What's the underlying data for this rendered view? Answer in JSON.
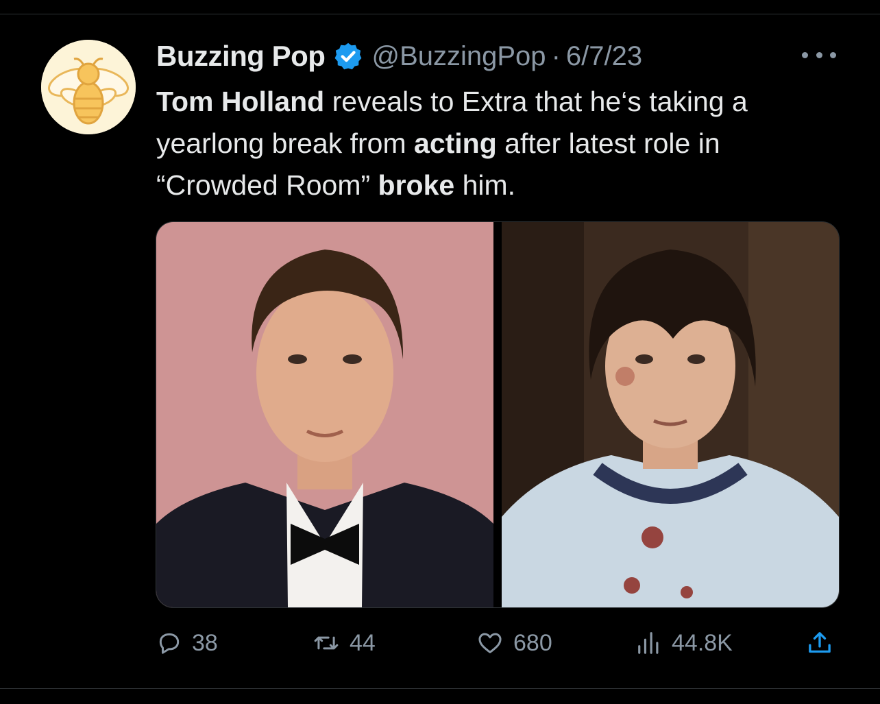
{
  "tweet": {
    "author_name": "Buzzing Pop",
    "handle": "@BuzzingPop",
    "separator": "·",
    "date": "6/7/23",
    "verified_color": "#1d9bf0",
    "text_segments": [
      {
        "text": "Tom Holland",
        "bold": true
      },
      {
        "text": " reveals to Extra that he‘s taking a yearlong break from ",
        "bold": false
      },
      {
        "text": "acting",
        "bold": true
      },
      {
        "text": " after latest role in “Crowded Room” ",
        "bold": false
      },
      {
        "text": "broke",
        "bold": true
      },
      {
        "text": " him.",
        "bold": false
      }
    ],
    "media": [
      {
        "icon": "portrait-photo-tuxedo"
      },
      {
        "icon": "portrait-photo-bloody-shirt"
      }
    ]
  },
  "actions": {
    "replies": "38",
    "retweets": "44",
    "likes": "680",
    "views": "44.8K"
  },
  "icons": {
    "avatar": "bee-logo-icon",
    "more": "more-dots-icon",
    "reply": "reply-icon",
    "retweet": "retweet-icon",
    "like": "heart-icon",
    "views": "views-icon",
    "share": "share-icon"
  }
}
